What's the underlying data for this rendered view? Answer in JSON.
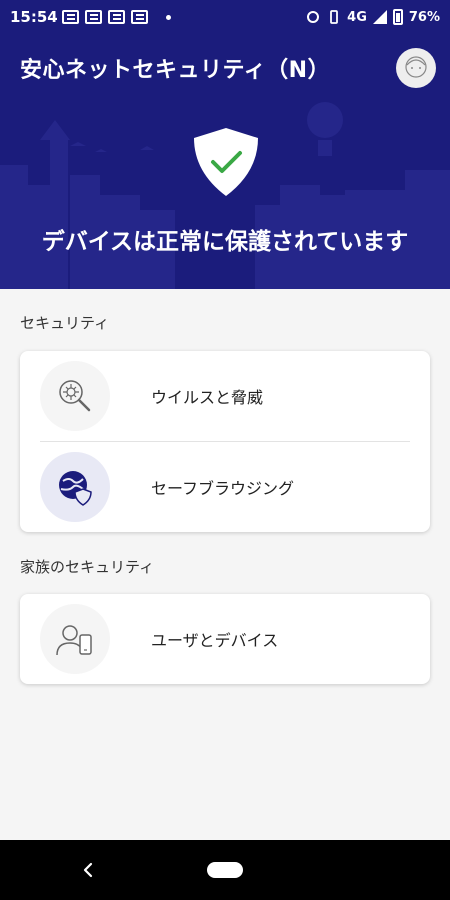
{
  "statusbar": {
    "time": "15:54",
    "network": "4G",
    "battery": "76%"
  },
  "header": {
    "title": "安心ネットセキュリティ（N）",
    "status_text": "デバイスは正常に保護されています"
  },
  "sections": [
    {
      "label": "セキュリティ",
      "items": [
        {
          "label": "ウイルスと脅威",
          "icon": "virus-search-icon"
        },
        {
          "label": "セーフブラウジング",
          "icon": "globe-shield-icon"
        }
      ]
    },
    {
      "label": "家族のセキュリティ",
      "items": [
        {
          "label": "ユーザとデバイス",
          "icon": "user-device-icon"
        }
      ]
    }
  ],
  "colors": {
    "header_bg": "#1b1c7c",
    "accent_green": "#3aa845"
  }
}
